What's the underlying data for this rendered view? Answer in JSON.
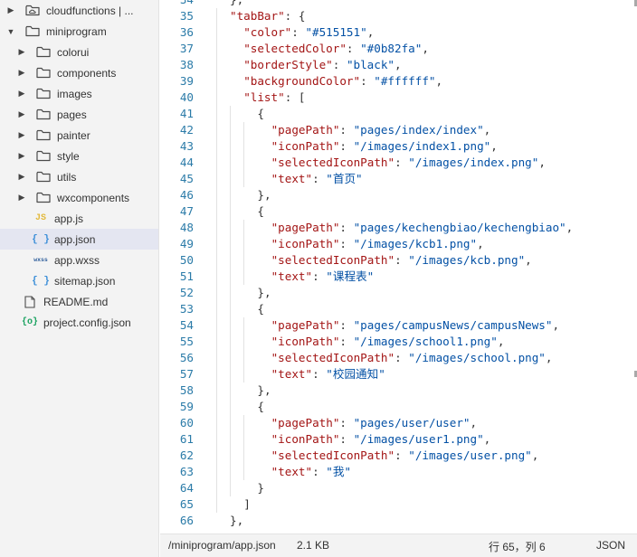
{
  "sidebar": {
    "items": [
      {
        "label": "cloudfunctions | ...",
        "icon": "folder-cloud-icon",
        "expanded": false,
        "type": "folder"
      },
      {
        "label": "miniprogram",
        "icon": "folder-icon",
        "expanded": true,
        "type": "folder"
      },
      {
        "label": "colorui",
        "icon": "folder-icon",
        "expanded": false,
        "type": "folder"
      },
      {
        "label": "components",
        "icon": "folder-icon",
        "expanded": false,
        "type": "folder"
      },
      {
        "label": "images",
        "icon": "folder-icon",
        "expanded": false,
        "type": "folder"
      },
      {
        "label": "pages",
        "icon": "folder-icon",
        "expanded": false,
        "type": "folder"
      },
      {
        "label": "painter",
        "icon": "folder-icon",
        "expanded": false,
        "type": "folder"
      },
      {
        "label": "style",
        "icon": "folder-icon",
        "expanded": false,
        "type": "folder"
      },
      {
        "label": "utils",
        "icon": "folder-icon",
        "expanded": false,
        "type": "folder"
      },
      {
        "label": "wxcomponents",
        "icon": "folder-icon",
        "expanded": false,
        "type": "folder"
      },
      {
        "label": "app.js",
        "icon": "js-file-icon",
        "icon_text": "JS",
        "type": "file"
      },
      {
        "label": "app.json",
        "icon": "json-file-icon",
        "icon_text": "{ }",
        "type": "file",
        "selected": true
      },
      {
        "label": "app.wxss",
        "icon": "wxss-file-icon",
        "icon_text": "wxss",
        "type": "file"
      },
      {
        "label": "sitemap.json",
        "icon": "json-file-icon",
        "icon_text": "{ }",
        "type": "file"
      },
      {
        "label": "README.md",
        "icon": "markdown-file-icon",
        "type": "file"
      },
      {
        "label": "project.config.json",
        "icon": "config-file-icon",
        "icon_text": "{o}",
        "type": "file"
      }
    ]
  },
  "editor": {
    "lines": [
      {
        "num": "34",
        "tokens": [
          {
            "t": "p",
            "v": "},"
          }
        ]
      },
      {
        "num": "35",
        "tokens": [
          {
            "t": "k",
            "v": "\"tabBar\""
          },
          {
            "t": "p",
            "v": ": {"
          }
        ]
      },
      {
        "num": "36",
        "tokens": [
          {
            "t": "k",
            "v": "\"color\""
          },
          {
            "t": "p",
            "v": ": "
          },
          {
            "t": "s",
            "v": "\"#515151\""
          },
          {
            "t": "p",
            "v": ","
          }
        ]
      },
      {
        "num": "37",
        "tokens": [
          {
            "t": "k",
            "v": "\"selectedColor\""
          },
          {
            "t": "p",
            "v": ": "
          },
          {
            "t": "s",
            "v": "\"#0b82fa\""
          },
          {
            "t": "p",
            "v": ","
          }
        ]
      },
      {
        "num": "38",
        "tokens": [
          {
            "t": "k",
            "v": "\"borderStyle\""
          },
          {
            "t": "p",
            "v": ": "
          },
          {
            "t": "s",
            "v": "\"black\""
          },
          {
            "t": "p",
            "v": ","
          }
        ]
      },
      {
        "num": "39",
        "tokens": [
          {
            "t": "k",
            "v": "\"backgroundColor\""
          },
          {
            "t": "p",
            "v": ": "
          },
          {
            "t": "s",
            "v": "\"#ffffff\""
          },
          {
            "t": "p",
            "v": ","
          }
        ]
      },
      {
        "num": "40",
        "tokens": [
          {
            "t": "k",
            "v": "\"list\""
          },
          {
            "t": "p",
            "v": ": ["
          }
        ]
      },
      {
        "num": "41",
        "tokens": [
          {
            "t": "p",
            "v": "{"
          }
        ]
      },
      {
        "num": "42",
        "tokens": [
          {
            "t": "k",
            "v": "\"pagePath\""
          },
          {
            "t": "p",
            "v": ": "
          },
          {
            "t": "s",
            "v": "\"pages/index/index\""
          },
          {
            "t": "p",
            "v": ","
          }
        ]
      },
      {
        "num": "43",
        "tokens": [
          {
            "t": "k",
            "v": "\"iconPath\""
          },
          {
            "t": "p",
            "v": ": "
          },
          {
            "t": "s",
            "v": "\"/images/index1.png\""
          },
          {
            "t": "p",
            "v": ","
          }
        ]
      },
      {
        "num": "44",
        "tokens": [
          {
            "t": "k",
            "v": "\"selectedIconPath\""
          },
          {
            "t": "p",
            "v": ": "
          },
          {
            "t": "s",
            "v": "\"/images/index.png\""
          },
          {
            "t": "p",
            "v": ","
          }
        ]
      },
      {
        "num": "45",
        "tokens": [
          {
            "t": "k",
            "v": "\"text\""
          },
          {
            "t": "p",
            "v": ": "
          },
          {
            "t": "s",
            "v": "\"首页\""
          }
        ]
      },
      {
        "num": "46",
        "tokens": [
          {
            "t": "p",
            "v": "},"
          }
        ]
      },
      {
        "num": "47",
        "tokens": [
          {
            "t": "p",
            "v": "{"
          }
        ]
      },
      {
        "num": "48",
        "tokens": [
          {
            "t": "k",
            "v": "\"pagePath\""
          },
          {
            "t": "p",
            "v": ": "
          },
          {
            "t": "s",
            "v": "\"pages/kechengbiao/kechengbiao\""
          },
          {
            "t": "p",
            "v": ","
          }
        ]
      },
      {
        "num": "49",
        "tokens": [
          {
            "t": "k",
            "v": "\"iconPath\""
          },
          {
            "t": "p",
            "v": ": "
          },
          {
            "t": "s",
            "v": "\"/images/kcb1.png\""
          },
          {
            "t": "p",
            "v": ","
          }
        ]
      },
      {
        "num": "50",
        "tokens": [
          {
            "t": "k",
            "v": "\"selectedIconPath\""
          },
          {
            "t": "p",
            "v": ": "
          },
          {
            "t": "s",
            "v": "\"/images/kcb.png\""
          },
          {
            "t": "p",
            "v": ","
          }
        ]
      },
      {
        "num": "51",
        "tokens": [
          {
            "t": "k",
            "v": "\"text\""
          },
          {
            "t": "p",
            "v": ": "
          },
          {
            "t": "s",
            "v": "\"课程表\""
          }
        ]
      },
      {
        "num": "52",
        "tokens": [
          {
            "t": "p",
            "v": "},"
          }
        ]
      },
      {
        "num": "53",
        "tokens": [
          {
            "t": "p",
            "v": "{"
          }
        ]
      },
      {
        "num": "54",
        "tokens": [
          {
            "t": "k",
            "v": "\"pagePath\""
          },
          {
            "t": "p",
            "v": ": "
          },
          {
            "t": "s",
            "v": "\"pages/campusNews/campusNews\""
          },
          {
            "t": "p",
            "v": ","
          }
        ]
      },
      {
        "num": "55",
        "tokens": [
          {
            "t": "k",
            "v": "\"iconPath\""
          },
          {
            "t": "p",
            "v": ": "
          },
          {
            "t": "s",
            "v": "\"/images/school1.png\""
          },
          {
            "t": "p",
            "v": ","
          }
        ]
      },
      {
        "num": "56",
        "tokens": [
          {
            "t": "k",
            "v": "\"selectedIconPath\""
          },
          {
            "t": "p",
            "v": ": "
          },
          {
            "t": "s",
            "v": "\"/images/school.png\""
          },
          {
            "t": "p",
            "v": ","
          }
        ]
      },
      {
        "num": "57",
        "tokens": [
          {
            "t": "k",
            "v": "\"text\""
          },
          {
            "t": "p",
            "v": ": "
          },
          {
            "t": "s",
            "v": "\"校园通知\""
          }
        ]
      },
      {
        "num": "58",
        "tokens": [
          {
            "t": "p",
            "v": "},"
          }
        ]
      },
      {
        "num": "59",
        "tokens": [
          {
            "t": "p",
            "v": "{"
          }
        ]
      },
      {
        "num": "60",
        "tokens": [
          {
            "t": "k",
            "v": "\"pagePath\""
          },
          {
            "t": "p",
            "v": ": "
          },
          {
            "t": "s",
            "v": "\"pages/user/user\""
          },
          {
            "t": "p",
            "v": ","
          }
        ]
      },
      {
        "num": "61",
        "tokens": [
          {
            "t": "k",
            "v": "\"iconPath\""
          },
          {
            "t": "p",
            "v": ": "
          },
          {
            "t": "s",
            "v": "\"/images/user1.png\""
          },
          {
            "t": "p",
            "v": ","
          }
        ]
      },
      {
        "num": "62",
        "tokens": [
          {
            "t": "k",
            "v": "\"selectedIconPath\""
          },
          {
            "t": "p",
            "v": ": "
          },
          {
            "t": "s",
            "v": "\"/images/user.png\""
          },
          {
            "t": "p",
            "v": ","
          }
        ]
      },
      {
        "num": "63",
        "tokens": [
          {
            "t": "k",
            "v": "\"text\""
          },
          {
            "t": "p",
            "v": ": "
          },
          {
            "t": "s",
            "v": "\"我\""
          }
        ]
      },
      {
        "num": "64",
        "tokens": [
          {
            "t": "p",
            "v": "}"
          }
        ]
      },
      {
        "num": "65",
        "tokens": [
          {
            "t": "p",
            "v": "]"
          }
        ]
      },
      {
        "num": "66",
        "tokens": [
          {
            "t": "p",
            "v": "},"
          }
        ]
      }
    ]
  },
  "statusbar": {
    "path": "/miniprogram/app.json",
    "size": "2.1 KB",
    "position": "行 65，列 6",
    "language": "JSON"
  },
  "colors": {
    "key": "#a31515",
    "string": "#0451a5",
    "line_number": "#2b7ba8",
    "selected_row": "#e4e6f1",
    "sidebar_bg": "#f3f3f3"
  }
}
